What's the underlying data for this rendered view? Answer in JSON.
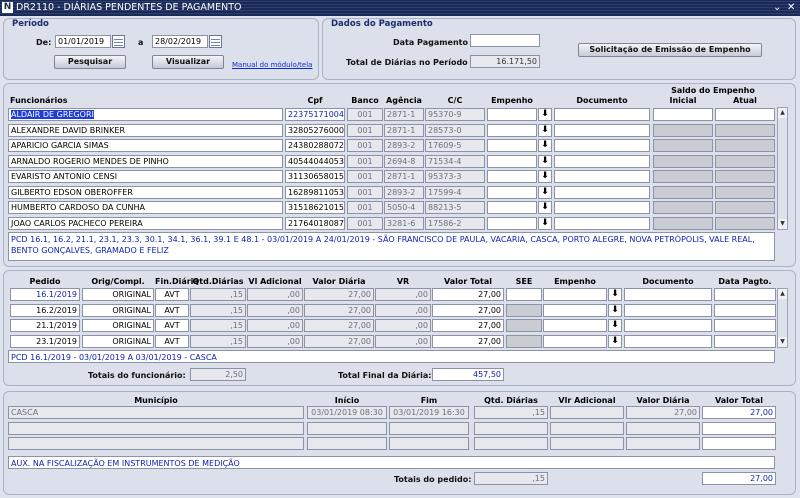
{
  "window": {
    "title": "DR2110 - DIÁRIAS PENDENTES DE PAGAMENTO",
    "controls": "⌄ ✕"
  },
  "periodo": {
    "title": "Período",
    "de_label": "De:",
    "de_value": "01/01/2019",
    "a_label": "a",
    "a_value": "28/02/2019",
    "pesquisar": "Pesquisar",
    "visualizar": "Visualizar",
    "manual": "Manual do módulo/tela"
  },
  "pagamento": {
    "title": "Dados do Pagamento",
    "data_label": "Data Pagamento",
    "data_value": "",
    "total_label": "Total de Diárias no Período",
    "total_value": "16.171,50",
    "solicitacao": "Solicitação de Emissão de Empenho"
  },
  "func_headers": {
    "funcionarios": "Funcionários",
    "cpf": "Cpf",
    "banco": "Banco",
    "agencia": "Agência",
    "cc": "C/C",
    "empenho": "Empenho",
    "documento": "Documento",
    "saldo": "Saldo do Empenho",
    "inicial": "Inicial",
    "atual": "Atual"
  },
  "funcionarios": [
    {
      "nome": "ALDAIR DE GREGORI",
      "cpf": "22375171004",
      "banco": "001",
      "agencia": "2871-1",
      "cc": "95370-9"
    },
    {
      "nome": "ALEXANDRE DAVID BRINKER",
      "cpf": "32805276000",
      "banco": "001",
      "agencia": "2871-1",
      "cc": "28573-0"
    },
    {
      "nome": "APARICIO GARCIA SIMAS",
      "cpf": "24380288072",
      "banco": "001",
      "agencia": "2893-2",
      "cc": "17609-5"
    },
    {
      "nome": "ARNALDO ROGERIO MENDES DE PINHO",
      "cpf": "40544044053",
      "banco": "001",
      "agencia": "2694-8",
      "cc": "71534-4"
    },
    {
      "nome": "EVARISTO ANTONIO CENSI",
      "cpf": "31130658015",
      "banco": "001",
      "agencia": "2871-1",
      "cc": "95373-3"
    },
    {
      "nome": "GILBERTO EDSON OBEROFFER",
      "cpf": "16289811053",
      "banco": "001",
      "agencia": "2893-2",
      "cc": "17599-4"
    },
    {
      "nome": "HUMBERTO CARDOSO DA CUNHA",
      "cpf": "31518621015",
      "banco": "001",
      "agencia": "5050-4",
      "cc": "88213-5"
    },
    {
      "nome": "JOAO CARLOS PACHECO PEREIRA",
      "cpf": "21764018087",
      "banco": "001",
      "agencia": "3281-6",
      "cc": "17586-2"
    }
  ],
  "pcd_note": "PCD 16.1, 16.2, 21.1, 23.1, 23.3, 30.1, 34.1, 36.1, 39.1 E 48.1 - 03/01/2019 A 24/01/2019 -  SÃO FRANCISCO DE PAULA, VACARIA, CASCA, PORTO ALEGRE, NOVA PETRÓPOLIS, VALE REAL, BENTO GONÇALVES, GRAMADO E FELIZ",
  "ped_headers": {
    "pedido": "Pedido",
    "orig": "Orig/Compl.",
    "fin": "Fin.Diária",
    "qtd": "Qtd.Diárias",
    "vladic": "Vl Adicional",
    "vdiaria": "Valor Diária",
    "vr": "VR",
    "vtotal": "Valor Total",
    "see": "SEE",
    "empenho": "Empenho",
    "documento": "Documento",
    "datapagto": "Data Pagto."
  },
  "pedidos": [
    {
      "pedido": "16.1/2019",
      "orig": "ORIGINAL",
      "fin": "AVT",
      "qtd": ",15",
      ".00": ".00",
      "vladic": ",00",
      "vdiaria": "27,00",
      "vr": ",00",
      "vtotal": "27,00"
    },
    {
      "pedido": "16.2/2019",
      "orig": "ORIGINAL",
      "fin": "AVT",
      "qtd": ",15",
      "vladic": ",00",
      "vdiaria": "27,00",
      "vr": ",00",
      "vtotal": "27,00"
    },
    {
      "pedido": "21.1/2019",
      "orig": "ORIGINAL",
      "fin": "AVT",
      "qtd": ",15",
      "vladic": ",00",
      "vdiaria": "27,00",
      "vr": ",00",
      "vtotal": "27,00"
    },
    {
      "pedido": "23.1/2019",
      "orig": "ORIGINAL",
      "fin": "AVT",
      "qtd": ",15",
      "vladic": ",00",
      "vdiaria": "27,00",
      "vr": ",00",
      "vtotal": "27,00"
    }
  ],
  "ped_note": "PCD 16.1/2019 - 03/01/2019 A 03/01/2019 - CASCA",
  "totais_func": {
    "label": "Totais do funcionário:",
    "value": "2,50"
  },
  "total_final": {
    "label": "Total Final da Diária:",
    "value": "457,50"
  },
  "mun_headers": {
    "municipio": "Município",
    "inicio": "Início",
    "fim": "Fim",
    "qtd": "Qtd. Diárias",
    "vladic": "Vlr Adicional",
    "vdiaria": "Valor Diária",
    "vtotal": "Valor Total"
  },
  "municipios": [
    {
      "municipio": "CASCA",
      "inicio": "03/01/2019 08:30",
      "fim": "03/01/2019 16:30",
      "qtd": ",15",
      "vladic": "",
      "vdiaria": "27,00",
      "vtotal": "27,00"
    }
  ],
  "mun_note": "AUX. NA FISCALIZAÇÃO EM INSTRUMENTOS DE MEDIÇÃO",
  "totais_pedido": {
    "label": "Totais do pedido:",
    "qtd": ",15",
    "total": "27,00"
  }
}
